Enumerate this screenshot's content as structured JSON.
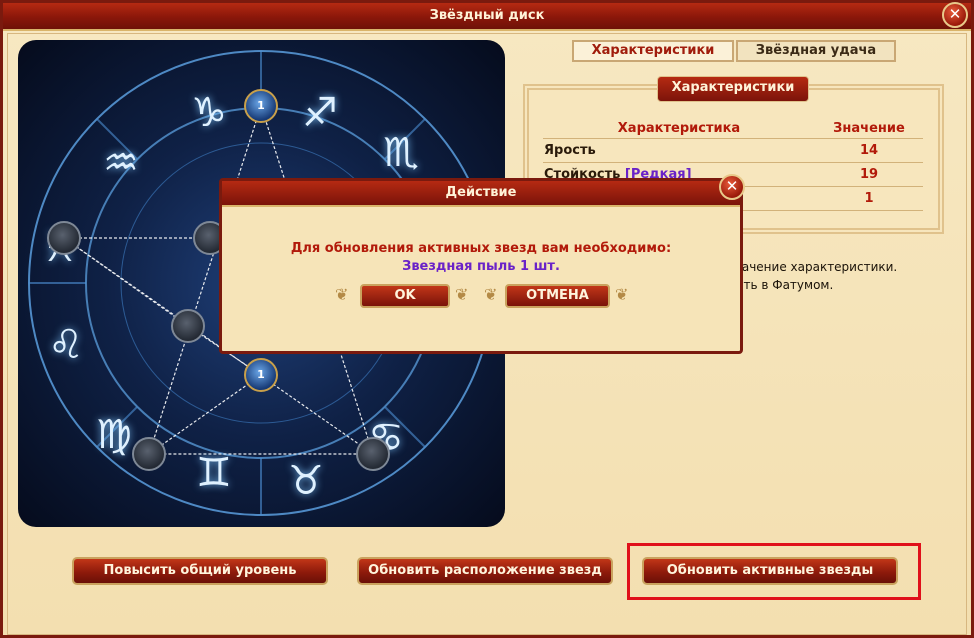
{
  "window": {
    "title": "Звёздный диск",
    "close_symbol": "✕"
  },
  "tabs": [
    {
      "label": "Характеристики",
      "active": true
    },
    {
      "label": "Звёздная удача",
      "active": false
    }
  ],
  "stats": {
    "header": "Характеристики",
    "col_name": "Характеристика",
    "col_value": "Значение",
    "rows": [
      {
        "name": "Ярость",
        "rarity": "",
        "value": "14"
      },
      {
        "name": "Стойкость",
        "rarity": "[Редкая]",
        "value": "19"
      },
      {
        "name": "",
        "rarity": "",
        "value": "1"
      }
    ]
  },
  "description": {
    "line1": "начение характеристики.",
    "line2": "ыть в Фатумом."
  },
  "zodiac": {
    "active_node_label": "1",
    "nodes": [
      {
        "label": "1",
        "active": true
      },
      {
        "label": "1",
        "active": true
      },
      {
        "label": "",
        "active": false
      },
      {
        "label": "",
        "active": false
      },
      {
        "label": "",
        "active": false
      },
      {
        "label": "",
        "active": false
      },
      {
        "label": "",
        "active": false
      }
    ],
    "signs": [
      "♑",
      "♐",
      "♏",
      "♒",
      "♓",
      "♌",
      "♋",
      "♊",
      "♍",
      "♉"
    ]
  },
  "buttons": {
    "raise_level": "Повысить общий уровень",
    "update_layout": "Обновить расположение звезд",
    "update_active": "Обновить активные звезды"
  },
  "dialog": {
    "title": "Действие",
    "close_symbol": "✕",
    "message": "Для обновления активных звезд вам необходимо:",
    "requirement_item": "Звездная пыль",
    "requirement_rest": " 1 шт.",
    "ok": "OK",
    "cancel": "ОТМЕНА"
  },
  "colors": {
    "accent_red": "#b21a0a",
    "rare_purple": "#6a22c8",
    "highlight": "#e0101a"
  }
}
